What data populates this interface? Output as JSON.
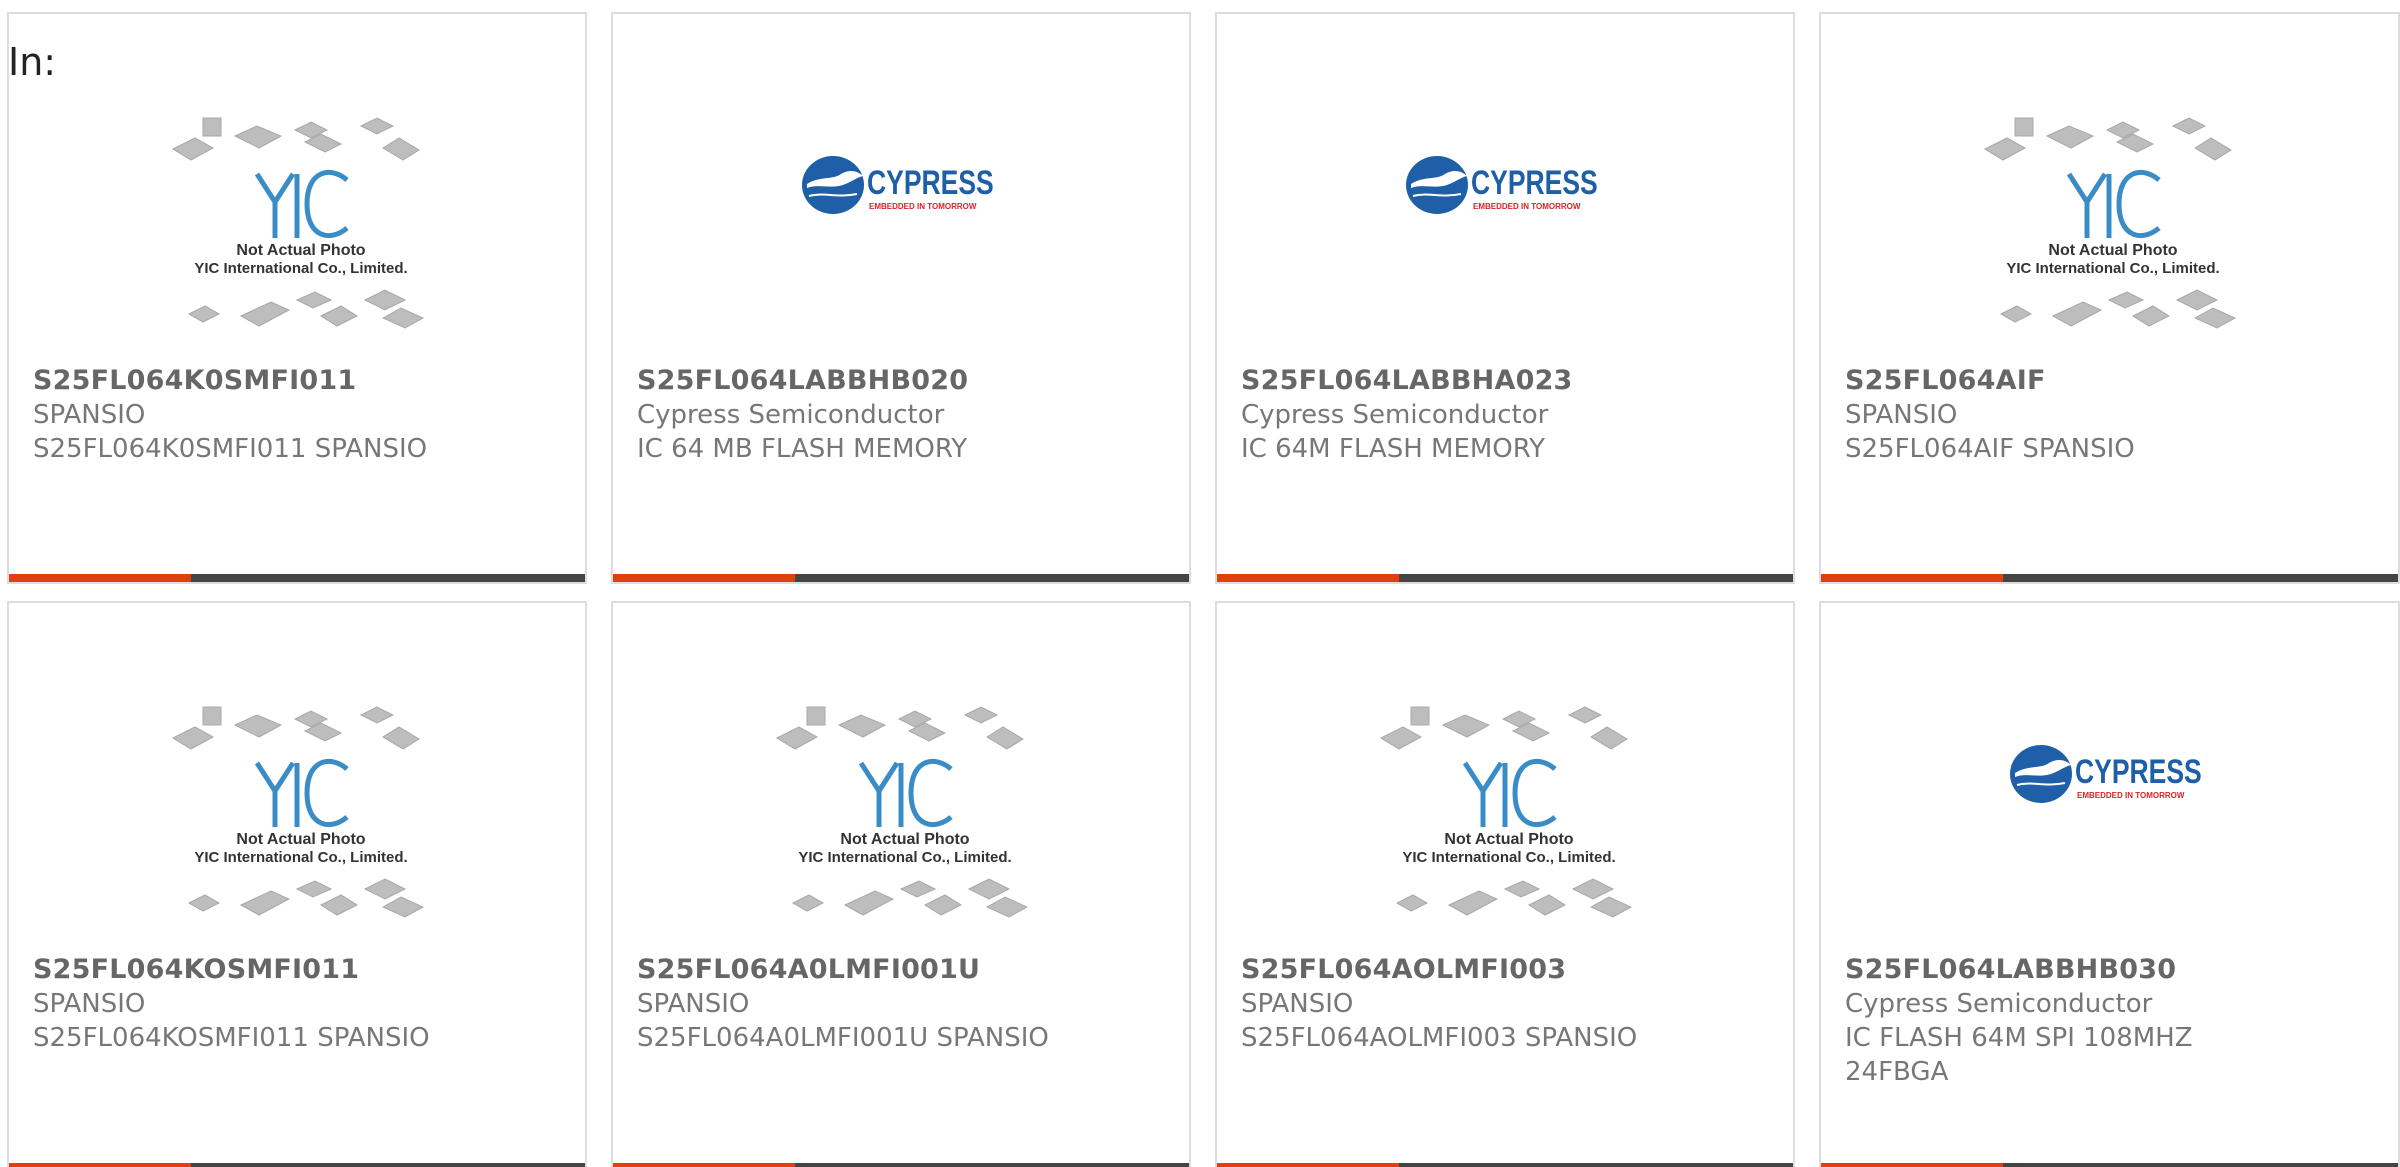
{
  "header": {
    "label": "In:"
  },
  "colors": {
    "accent": "#e04010",
    "bar": "#444444",
    "yic_blue": "#3a8cc7",
    "cypress_blue": "#1f5fa8",
    "cypress_red": "#d8232a"
  },
  "cards": [
    {
      "part": "S25FL064K0SMFI011",
      "manufacturer": "SPANSIO",
      "description": "S25FL064K0SMFI011 SPANSIO",
      "image": "yic-placeholder",
      "img_text": {
        "line1": "Not Actual Photo",
        "line2": "YIC International Co., Limited."
      }
    },
    {
      "part": "S25FL064LABBHB020",
      "manufacturer": "Cypress Semiconductor",
      "description": "IC 64 MB FLASH MEMORY",
      "image": "cypress-logo",
      "img_text": {
        "brand": "CYPRESS",
        "tagline": "EMBEDDED IN TOMORROW"
      }
    },
    {
      "part": "S25FL064LABBHA023",
      "manufacturer": "Cypress Semiconductor",
      "description": "IC 64M FLASH MEMORY",
      "image": "cypress-logo",
      "img_text": {
        "brand": "CYPRESS",
        "tagline": "EMBEDDED IN TOMORROW"
      }
    },
    {
      "part": "S25FL064AIF",
      "manufacturer": "SPANSIO",
      "description": "S25FL064AIF SPANSIO",
      "image": "yic-placeholder",
      "img_text": {
        "line1": "Not Actual Photo",
        "line2": "YIC International Co., Limited."
      }
    },
    {
      "part": "S25FL064KOSMFI011",
      "manufacturer": "SPANSIO",
      "description": "S25FL064KOSMFI011 SPANSIO",
      "image": "yic-placeholder",
      "img_text": {
        "line1": "Not Actual Photo",
        "line2": "YIC International Co., Limited."
      }
    },
    {
      "part": "S25FL064A0LMFI001U",
      "manufacturer": "SPANSIO",
      "description": "S25FL064A0LMFI001U SPANSIO",
      "image": "yic-placeholder",
      "img_text": {
        "line1": "Not Actual Photo",
        "line2": "YIC International Co., Limited."
      }
    },
    {
      "part": "S25FL064AOLMFI003",
      "manufacturer": "SPANSIO",
      "description": "S25FL064AOLMFI003 SPANSIO",
      "image": "yic-placeholder",
      "img_text": {
        "line1": "Not Actual Photo",
        "line2": "YIC International Co., Limited."
      }
    },
    {
      "part": "S25FL064LABBHB030",
      "manufacturer": "Cypress Semiconductor",
      "description": "IC FLASH 64M SPI 108MHZ 24FBGA",
      "image": "cypress-logo",
      "img_text": {
        "brand": "CYPRESS",
        "tagline": "EMBEDDED IN TOMORROW"
      }
    }
  ]
}
